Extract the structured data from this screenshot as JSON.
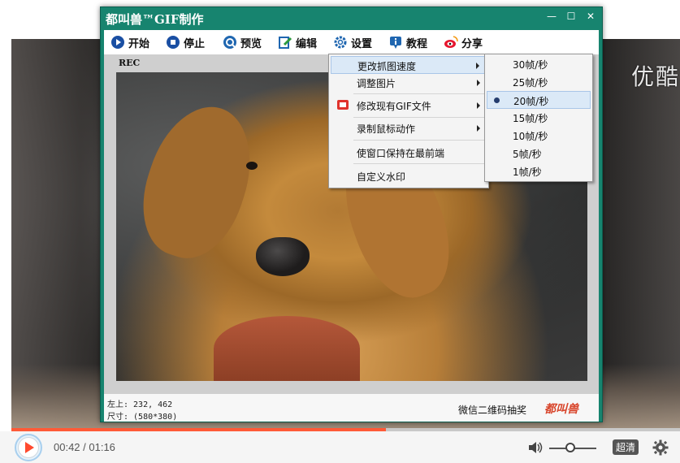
{
  "video_player": {
    "watermark": "优酷",
    "time_display": "00:42 / 01:16",
    "progress": 0.56,
    "volume": 0.45,
    "quality_label": "超清",
    "play_icon": "play-icon",
    "volume_icon": "speaker-icon",
    "settings_icon": "gear-icon",
    "accent_color": "#ff5a37"
  },
  "app": {
    "title": "都叫兽™GIF制作",
    "window_buttons": {
      "minimize": "—",
      "maximize": "☐",
      "close": "✕"
    },
    "toolbar": {
      "start": "开始",
      "stop": "停止",
      "preview": "预览",
      "edit": "编辑",
      "settings": "设置",
      "tutorial": "教程",
      "share": "分享"
    },
    "rec_label": "REC",
    "status": {
      "position": "左上: 232, 462",
      "size": "尺寸: (580*380)",
      "promo": "微信二维码抽奖",
      "brand": "都叫兽"
    },
    "theme_color": "#17846f"
  },
  "settings_menu": {
    "items": [
      {
        "label": "更改抓图速度",
        "has_submenu": true,
        "highlighted": true
      },
      {
        "label": "调整图片",
        "has_submenu": true
      },
      {
        "label": "修改现有GIF文件",
        "has_submenu": true,
        "icon": "gif-file-icon"
      },
      {
        "label": "录制鼠标动作",
        "has_submenu": true
      },
      {
        "label": "使窗口保持在最前端",
        "has_submenu": false
      },
      {
        "label": "自定义水印",
        "has_submenu": false
      }
    ]
  },
  "speed_submenu": {
    "items": [
      {
        "label": "30帧/秒"
      },
      {
        "label": "25帧/秒"
      },
      {
        "label": "20帧/秒",
        "selected": true
      },
      {
        "label": "15帧/秒"
      },
      {
        "label": "10帧/秒"
      },
      {
        "label": "5帧/秒"
      },
      {
        "label": "1帧/秒"
      }
    ]
  }
}
